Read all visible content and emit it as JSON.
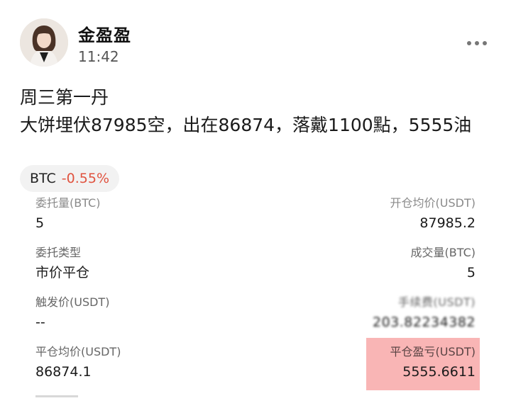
{
  "post": {
    "author_name": "金盈盈",
    "time": "11:42",
    "line1": "周三第一丹",
    "line2": "大饼埋伏87985空，出在86874，落戴1100點，5555油"
  },
  "ticker": {
    "symbol": "BTC",
    "change": "-0.55%",
    "change_color": "#e0533f"
  },
  "order": {
    "entrust_qty_label": "委托量(BTC)",
    "entrust_qty_value": "5",
    "open_avg_label": "开仓均价(USDT)",
    "open_avg_value": "87985.2",
    "entrust_type_label": "委托类型",
    "entrust_type_value": "市价平仓",
    "filled_qty_label": "成交量(BTC)",
    "filled_qty_value": "5",
    "trigger_price_label": "触发价(USDT)",
    "trigger_price_value": "--",
    "fee_label": "手续费(USDT)",
    "fee_value": "203.82234382",
    "close_avg_label": "平仓均价(USDT)",
    "close_avg_value": "86874.1",
    "close_pnl_label": "平仓盈亏(USDT)",
    "close_pnl_value": "5555.6611"
  },
  "icons": {
    "more": "more-horizontal-icon",
    "avatar": "avatar"
  }
}
